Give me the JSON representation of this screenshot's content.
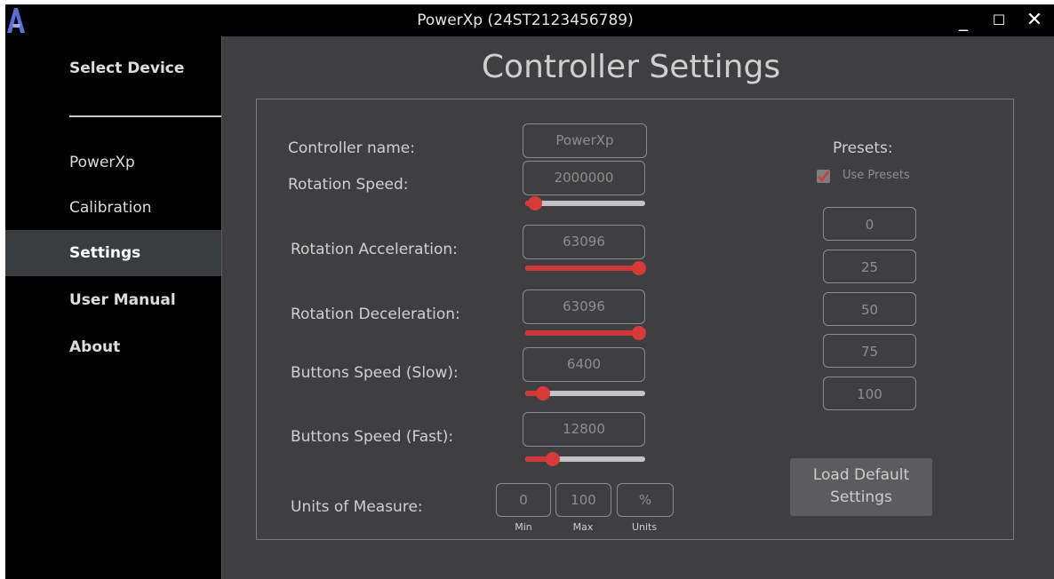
{
  "window": {
    "title": "PowerXp (24ST2123456789)"
  },
  "sidebar": {
    "items": [
      {
        "label": "Select Device"
      },
      {
        "label": "PowerXp"
      },
      {
        "label": "Calibration"
      },
      {
        "label": "Settings"
      },
      {
        "label": "User Manual"
      },
      {
        "label": "About"
      }
    ],
    "active": "Settings"
  },
  "main": {
    "title": "Controller Settings",
    "controller_name": {
      "label": "Controller name:",
      "value": "PowerXp"
    },
    "rotation_speed": {
      "label": "Rotation Speed:",
      "value": "2000000",
      "slider_fraction": 0.08
    },
    "rotation_acceleration": {
      "label": "Rotation Acceleration:",
      "value": "63096",
      "slider_fraction": 0.95
    },
    "rotation_deceleration": {
      "label": "Rotation Deceleration:",
      "value": "63096",
      "slider_fraction": 0.95
    },
    "buttons_speed_slow": {
      "label": "Buttons Speed (Slow):",
      "value": "6400",
      "slider_fraction": 0.15
    },
    "buttons_speed_fast": {
      "label": "Buttons Speed (Fast):",
      "value": "12800",
      "slider_fraction": 0.23
    },
    "units": {
      "label": "Units of Measure:",
      "min": {
        "value": "0",
        "caption": "Min"
      },
      "max": {
        "value": "100",
        "caption": "Max"
      },
      "unit": {
        "value": "%",
        "caption": "Units"
      }
    },
    "presets": {
      "label": "Presets:",
      "use_presets_label": "Use Presets",
      "use_presets_checked": true,
      "values": [
        "0",
        "25",
        "50",
        "75",
        "100"
      ]
    },
    "load_default_label": "Load Default Settings"
  },
  "colors": {
    "accent": "#d83a3a",
    "panel_bg": "#3f3f42",
    "sidebar_bg": "#000000",
    "active_item_bg": "#3a3d40"
  }
}
